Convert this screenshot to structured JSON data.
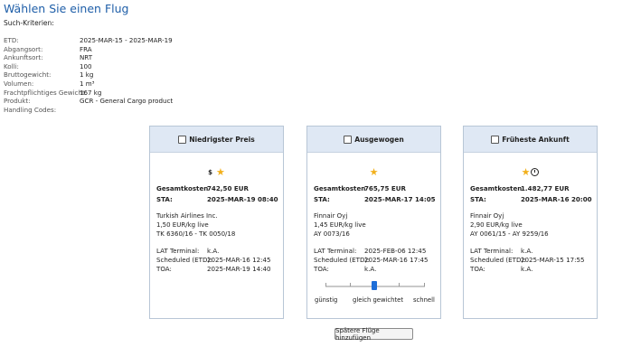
{
  "page": {
    "title": "Wählen Sie einen Flug",
    "criteria_title": "Such-Kriterien:"
  },
  "criteria": [
    {
      "label": "ETD:",
      "value": "2025-MAR-15 - 2025-MAR-19"
    },
    {
      "label": "Abgangsort:",
      "value": "FRA"
    },
    {
      "label": "Ankunftsort:",
      "value": "NRT"
    },
    {
      "label": "Kolli:",
      "value": "100"
    },
    {
      "label": "Bruttogewicht:",
      "value": "1 kg"
    },
    {
      "label": "Volumen:",
      "value": "1 m³"
    },
    {
      "label": "Frachtpflichtiges Gewicht:",
      "value": "167 kg"
    },
    {
      "label": "Produkt:",
      "value": "GCR - General Cargo product"
    },
    {
      "label": "Handling Codes:",
      "value": ""
    }
  ],
  "labels": {
    "total": "Gesamtkosten",
    "sta": "STA:",
    "lat_terminal": "LAT Terminal:",
    "scheduled": "Scheduled (ETD):",
    "toa": "TOA:"
  },
  "icons": {
    "star_color": "#f2b01c",
    "dollar": "$"
  },
  "cards": [
    {
      "title": "Niedrigster Preis",
      "total": "742,50 EUR",
      "sta": "2025-MAR-19 08:40",
      "airline": "Turkish Airlines Inc.",
      "rate": "1,50 EUR/kg  live",
      "flights": "TK 6360/16 - TK 0050/18",
      "lat_terminal": "k.A.",
      "scheduled": "2025-MAR-16 12:45",
      "toa": "2025-MAR-19 14:40"
    },
    {
      "title": "Ausgewogen",
      "total": "765,75 EUR",
      "sta": "2025-MAR-17 14:05",
      "airline": "Finnair Oyj",
      "rate": "1,45 EUR/kg  live",
      "flights": "AY 0073/16",
      "lat_terminal": "2025-FEB-06 12:45",
      "scheduled": "2025-MAR-16 17:45",
      "toa": "k.A."
    },
    {
      "title": "Früheste Ankunft",
      "total": "1.482,77 EUR",
      "sta": "2025-MAR-16 20:00",
      "airline": "Finnair Oyj",
      "rate": "2,90 EUR/kg  live",
      "flights": "AY 0061/15 - AY 9259/16",
      "lat_terminal": "k.A.",
      "scheduled": "2025-MAR-15 17:55",
      "toa": "k.A."
    }
  ],
  "slider": {
    "labels": [
      "günstig",
      "gleich gewichtet",
      "schnell"
    ],
    "selected": "gleich gewichtet"
  },
  "buttons": {
    "later_flights": "Spätere Flüge hinzufügen"
  }
}
